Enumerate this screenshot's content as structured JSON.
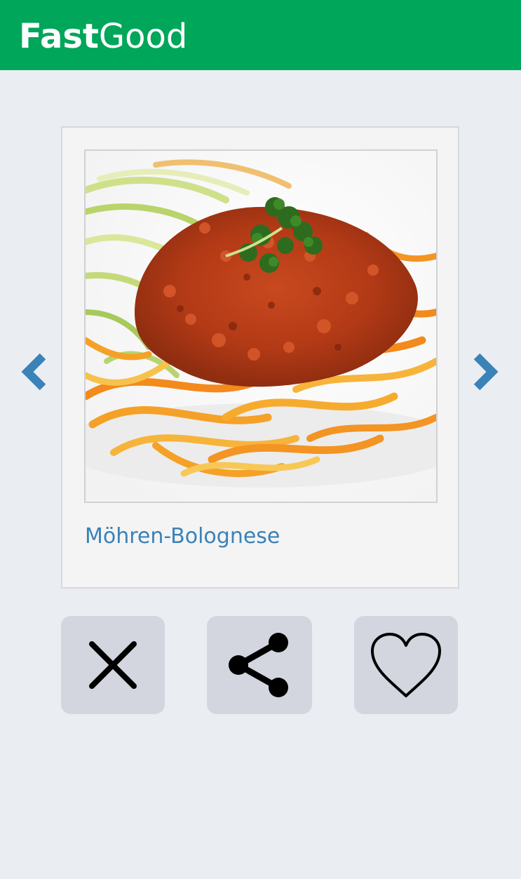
{
  "app": {
    "brand_bold": "Fast",
    "brand_light": "Good",
    "header_color": "#00a65a"
  },
  "card": {
    "image_alt": "Möhren-Bolognese",
    "title": "Möhren-Bolognese",
    "title_color": "#3a82b8"
  },
  "navigation": {
    "prev_icon": "chevron-left-icon",
    "next_icon": "chevron-right-icon",
    "arrow_color": "#3a82b8"
  },
  "actions": [
    {
      "name": "dismiss",
      "icon": "close-icon"
    },
    {
      "name": "share",
      "icon": "share-icon"
    },
    {
      "name": "like",
      "icon": "heart-icon"
    }
  ]
}
